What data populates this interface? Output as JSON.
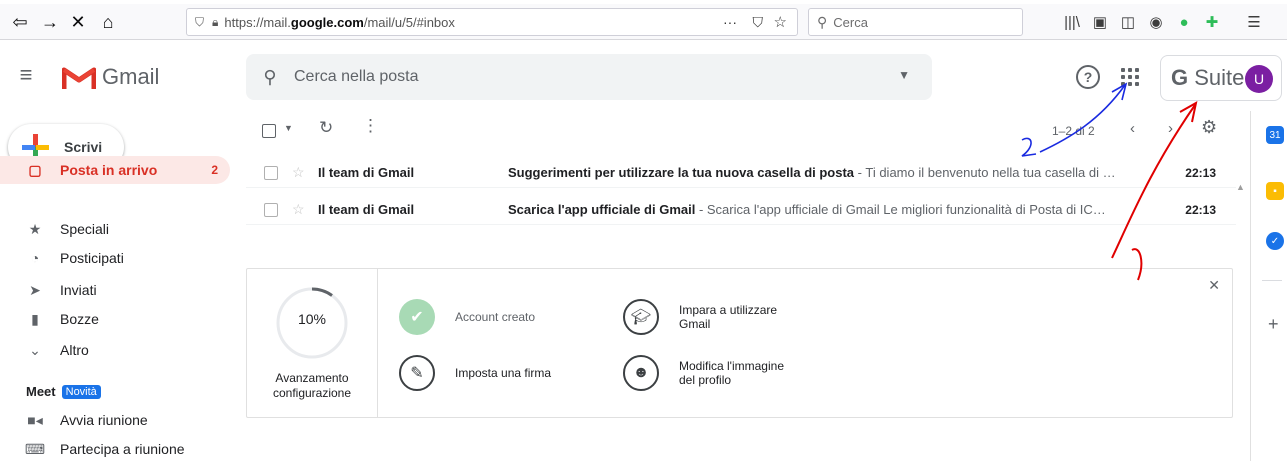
{
  "browser": {
    "url_prefix": "https://mail.",
    "url_domain": "google.com",
    "url_path": "/mail/u/5/#inbox",
    "search_placeholder": "Cerca"
  },
  "header": {
    "app_name": "Gmail",
    "search_placeholder": "Cerca nella posta",
    "gsuite_label": "Suite",
    "gsuite_g": "G",
    "avatar_letter": "U"
  },
  "compose": {
    "label": "Scrivi"
  },
  "sidebar": {
    "items": [
      {
        "label": "Posta in arrivo",
        "count": "2",
        "icon": "inbox-icon"
      },
      {
        "label": "Speciali",
        "icon": "star-icon"
      },
      {
        "label": "Posticipati",
        "icon": "clock-icon"
      },
      {
        "label": "Inviati",
        "icon": "send-icon"
      },
      {
        "label": "Bozze",
        "icon": "draft-icon"
      },
      {
        "label": "Altro",
        "icon": "chevron-down-icon"
      }
    ],
    "meet_title": "Meet",
    "meet_badge": "Novità",
    "meet_items": [
      {
        "label": "Avvia riunione",
        "icon": "video-icon"
      },
      {
        "label": "Partecipa a riunione",
        "icon": "keyboard-icon"
      }
    ]
  },
  "list": {
    "pager": "1–2 di 2",
    "rows": [
      {
        "sender": "Il team di Gmail",
        "subject": "Suggerimenti per utilizzare la tua nuova casella di posta",
        "snippet": " - Ti diamo il benvenuto nella tua casella di …",
        "time": "22:13"
      },
      {
        "sender": "Il team di Gmail",
        "subject": "Scarica l'app ufficiale di Gmail",
        "snippet": " - Scarica l'app ufficiale di Gmail Le migliori funzionalità di Posta di IC…",
        "time": "22:13"
      }
    ]
  },
  "setup": {
    "progress_value": 0.1,
    "progress_text": "10%",
    "progress_label_line1": "Avanzamento",
    "progress_label_line2": "configurazione",
    "tasks": [
      {
        "line1": "Account creato",
        "line2": "",
        "done": true,
        "icon": "check-icon"
      },
      {
        "line1": "Imposta una firma",
        "line2": "",
        "done": false,
        "icon": "pencil-icon"
      },
      {
        "line1": "Impara a utilizzare",
        "line2": "Gmail",
        "done": false,
        "icon": "graduation-cap-icon"
      },
      {
        "line1": "Modifica l'immagine",
        "line2": "del profilo",
        "done": false,
        "icon": "profile-icon"
      }
    ]
  },
  "annotations": {
    "label_1": "1",
    "label_2": "2",
    "color_1": "#e00000",
    "color_2": "#1a2be0"
  },
  "colors": {
    "accent_red": "#d93025",
    "avatar": "#7b1fa2",
    "badge_blue": "#1a73e8"
  }
}
